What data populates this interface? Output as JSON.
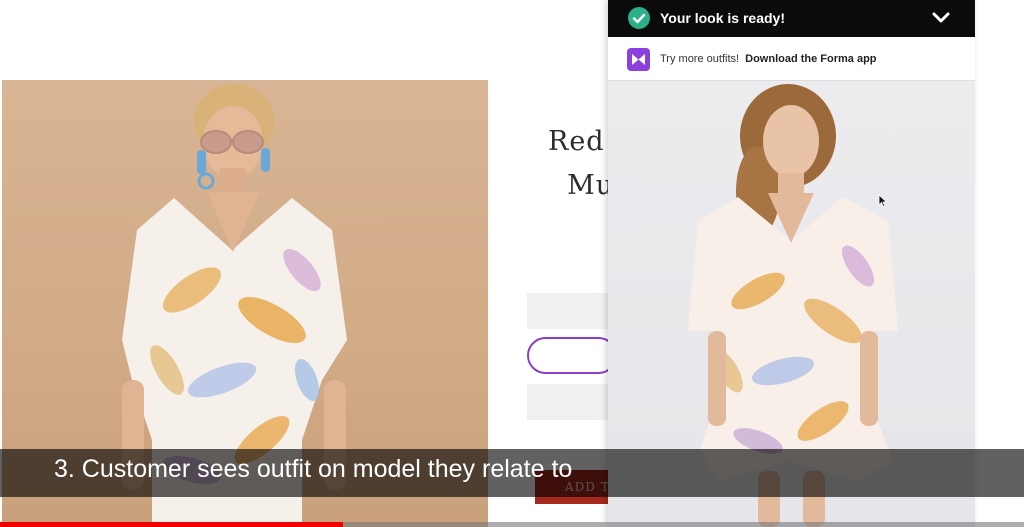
{
  "product": {
    "title": "Red\n  Mul",
    "add_to_bag_label": "ADD T"
  },
  "forma_panel": {
    "header_title": "Your look is ready!",
    "header_icon": "check-circle-icon",
    "collapse_icon": "chevron-down-icon",
    "promo_prefix": "Try more outfits!",
    "promo_link": "Download the Forma app",
    "logo_icon": "forma-logo-icon"
  },
  "video": {
    "caption": "3. Customer sees outfit on model they relate to",
    "progress": 0.335
  },
  "colors": {
    "accent_purple": "#8a3fc8",
    "forma_purple": "#8b3fdc",
    "success_green": "#2bb08a",
    "add_to_bag_red": "#a4281b",
    "youtube_red": "#f00000"
  }
}
